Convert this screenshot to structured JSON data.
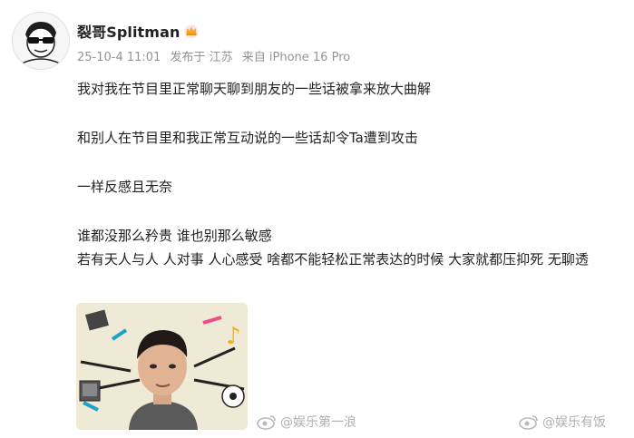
{
  "post": {
    "author": "裂哥Splitman",
    "time": "25-10-4 11:01",
    "location": "发布于 江苏",
    "source": "来自 iPhone 16 Pro",
    "lines": [
      "我对我在节目里正常聊天聊到朋友的一些话被拿来放大曲解",
      "和别人在节目里和我正常互动说的一些话却令Ta遭到攻击",
      "一样反感且无奈",
      "谁都没那么矜贵 谁也别那么敏感",
      "若有天人与人 人对事 人心感受 啥都不能轻松正常表达的时候 大家就都压抑死 无聊透"
    ]
  },
  "watermarks": [
    "@娱乐第一浪",
    "@娱乐有饭"
  ],
  "colors": {
    "accent": "#f5a623",
    "meta": "#939393"
  }
}
